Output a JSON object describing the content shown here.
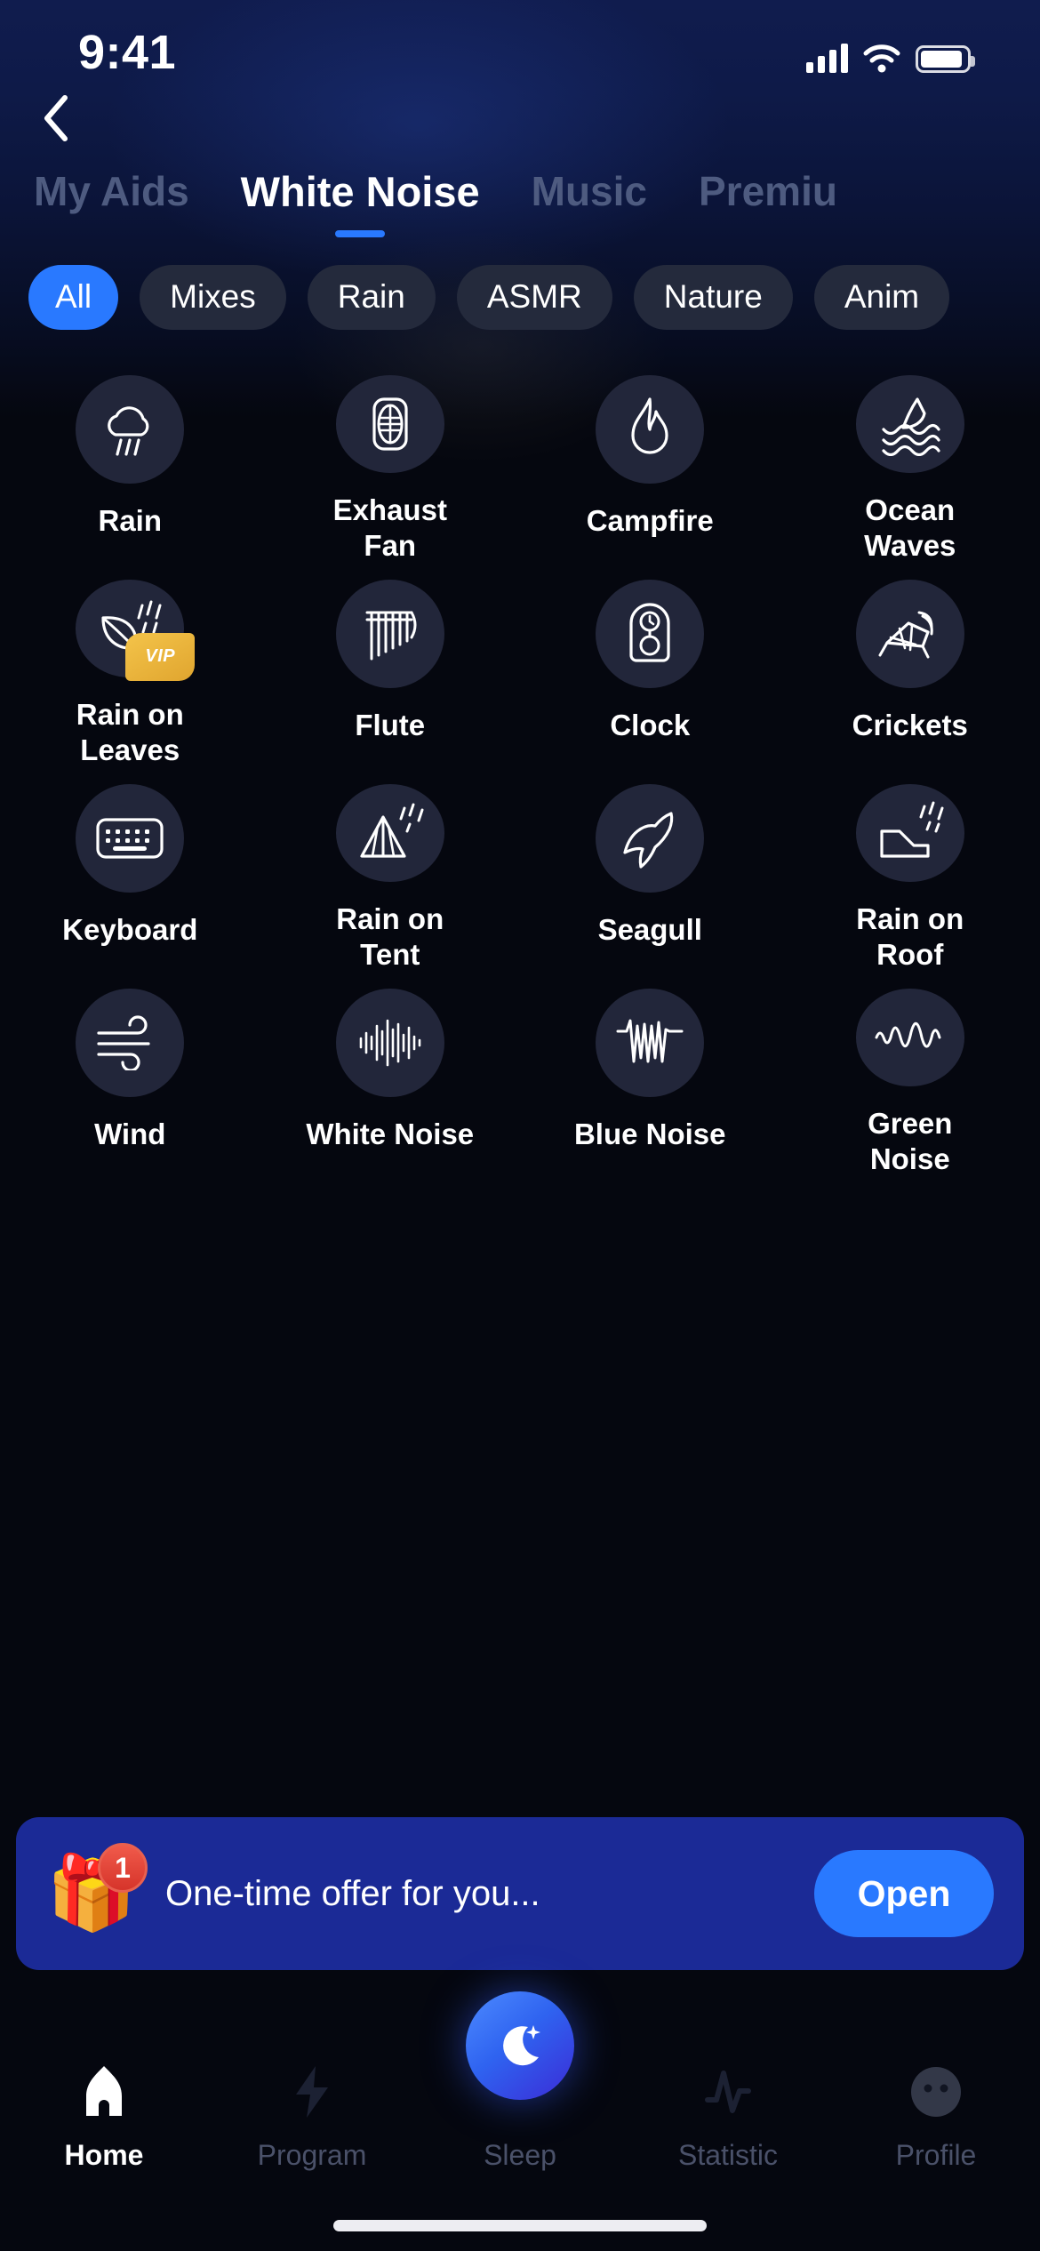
{
  "status_bar": {
    "time": "9:41",
    "signal_icon": "cellular-signal-icon",
    "wifi_icon": "wifi-icon",
    "battery_icon": "battery-icon"
  },
  "header": {
    "back_icon": "back-chevron-icon",
    "tabs": [
      {
        "label": "My Aids",
        "active": false
      },
      {
        "label": "White Noise",
        "active": true
      },
      {
        "label": "Music",
        "active": false
      },
      {
        "label": "Premiu",
        "active": false
      }
    ]
  },
  "filters": {
    "active_color": "#2979FF",
    "chips": [
      {
        "label": "All",
        "active": true
      },
      {
        "label": "Mixes",
        "active": false
      },
      {
        "label": "Rain",
        "active": false
      },
      {
        "label": "ASMR",
        "active": false
      },
      {
        "label": "Nature",
        "active": false
      },
      {
        "label": "Anim",
        "active": false
      }
    ]
  },
  "sounds": [
    {
      "label": "Rain",
      "icon": "rain-cloud-icon",
      "vip": false
    },
    {
      "label": "Exhaust Fan",
      "icon": "exhaust-fan-icon",
      "vip": false
    },
    {
      "label": "Campfire",
      "icon": "flame-icon",
      "vip": false
    },
    {
      "label": "Ocean Waves",
      "icon": "ocean-waves-icon",
      "vip": false
    },
    {
      "label": "Rain on Leaves",
      "icon": "rain-leaf-icon",
      "vip": true,
      "vip_label": "VIP"
    },
    {
      "label": "Flute",
      "icon": "flute-icon",
      "vip": false
    },
    {
      "label": "Clock",
      "icon": "clock-icon",
      "vip": false
    },
    {
      "label": "Crickets",
      "icon": "cricket-icon",
      "vip": false
    },
    {
      "label": "Keyboard",
      "icon": "keyboard-icon",
      "vip": false
    },
    {
      "label": "Rain on Tent",
      "icon": "rain-tent-icon",
      "vip": false
    },
    {
      "label": "Seagull",
      "icon": "seagull-icon",
      "vip": false
    },
    {
      "label": "Rain on Roof",
      "icon": "rain-roof-icon",
      "vip": false
    },
    {
      "label": "Wind",
      "icon": "wind-icon",
      "vip": false
    },
    {
      "label": "White Noise",
      "icon": "white-noise-wave-icon",
      "vip": false
    },
    {
      "label": "Blue Noise",
      "icon": "blue-noise-wave-icon",
      "vip": false
    },
    {
      "label": "Green Noise",
      "icon": "green-noise-wave-icon",
      "vip": false
    }
  ],
  "promo": {
    "gift_icon": "gift-icon",
    "badge_count": "1",
    "message": "One-time offer for you...",
    "button_label": "Open",
    "background_color": "#1B2A96",
    "button_color": "#2979FF"
  },
  "bottom_nav": [
    {
      "label": "Home",
      "icon": "home-icon",
      "active": true
    },
    {
      "label": "Program",
      "icon": "bolt-icon",
      "active": false
    },
    {
      "label": "Sleep",
      "icon": "moon-icon",
      "active": false
    },
    {
      "label": "Statistic",
      "icon": "pulse-icon",
      "active": false
    },
    {
      "label": "Profile",
      "icon": "profile-icon",
      "active": false
    }
  ]
}
